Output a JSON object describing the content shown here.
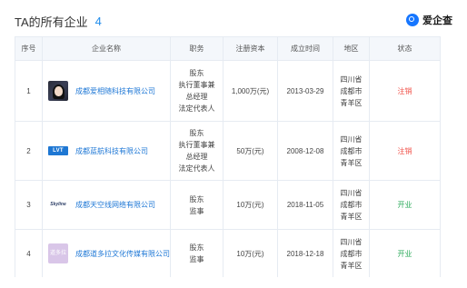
{
  "header": {
    "title": "TA的所有企业",
    "count": "4",
    "brand": "爱企查",
    "brand_icon": "qcc-logo-icon"
  },
  "table": {
    "columns": [
      "序号",
      "企业名称",
      "职务",
      "注册资本",
      "成立时间",
      "地区",
      "状态"
    ],
    "rows": [
      {
        "index": "1",
        "name": "成都爱相随科技有限公司",
        "logo": "portrait-logo",
        "roles": [
          "股东",
          "执行董事兼",
          "总经理",
          "法定代表人"
        ],
        "capital": "1,000万(元)",
        "founded": "2013-03-29",
        "region": [
          "四川省",
          "成都市",
          "青羊区"
        ],
        "status": "注销",
        "status_color": "#f0524a"
      },
      {
        "index": "2",
        "name": "成都蓝航科技有限公司",
        "logo": "LVT",
        "roles": [
          "股东",
          "执行董事兼",
          "总经理",
          "法定代表人"
        ],
        "capital": "50万(元)",
        "founded": "2008-12-08",
        "region": [
          "四川省",
          "成都市",
          "青羊区"
        ],
        "status": "注销",
        "status_color": "#f0524a"
      },
      {
        "index": "3",
        "name": "成都天空线网络有限公司",
        "logo": "Skyline",
        "roles": [
          "股东",
          "监事"
        ],
        "capital": "10万(元)",
        "founded": "2018-11-05",
        "region": [
          "四川省",
          "成都市",
          "青羊区"
        ],
        "status": "开业",
        "status_color": "#2aaa5a"
      },
      {
        "index": "4",
        "name": "成都道多拉文化传媒有限公司",
        "logo": "道多拉",
        "roles": [
          "股东",
          "监事"
        ],
        "capital": "10万(元)",
        "founded": "2018-12-18",
        "region": [
          "四川省",
          "成都市",
          "青羊区"
        ],
        "status": "开业",
        "status_color": "#2aaa5a"
      }
    ]
  }
}
